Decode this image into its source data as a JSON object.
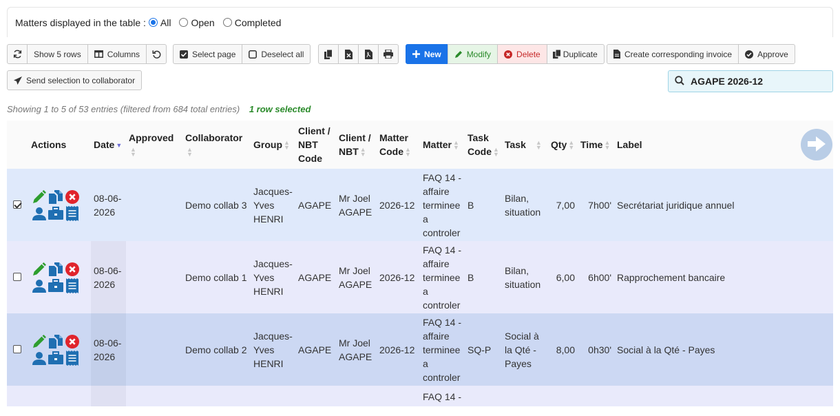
{
  "filter": {
    "label": "Matters displayed in the table :",
    "options": [
      "All",
      "Open",
      "Completed"
    ],
    "selected": "All"
  },
  "toolbar": {
    "show_rows": "Show 5 rows",
    "columns": "Columns",
    "select_page": "Select page",
    "deselect_all": "Deselect all",
    "new": "New",
    "modify": "Modify",
    "delete": "Delete",
    "duplicate": "Duplicate",
    "create_invoice": "Create corresponding invoice",
    "approve": "Approve",
    "send_selection": "Send selection to collaborator"
  },
  "search": {
    "value": "AGAPE 2026-12"
  },
  "info": {
    "showing": "Showing 1 to 5 of 53 entries (filtered from 684 total entries)",
    "selected": "1 row selected"
  },
  "table": {
    "headers": {
      "actions": "Actions",
      "date": "Date",
      "approved": "Approved",
      "collaborator": "Collaborator",
      "group": "Group",
      "client_code": "Client / NBT Code",
      "client": "Client / NBT",
      "matter_code": "Matter Code",
      "matter": "Matter",
      "task_code": "Task Code",
      "task": "Task",
      "qty": "Qty",
      "time": "Time",
      "label": "Label"
    },
    "rows": [
      {
        "selected": true,
        "date": "08-06-2026",
        "approved": "",
        "collaborator": "Demo collab 3",
        "group": "Jacques-Yves HENRI",
        "client_code": "AGAPE",
        "client": "Mr Joel AGAPE",
        "matter_code": "2026-12",
        "matter": "FAQ 14 - affaire terminee a controler",
        "task_code": "B",
        "task": "Bilan, situation",
        "qty": "7,00",
        "time": "7h00'",
        "label": "Secrétariat juridique annuel"
      },
      {
        "selected": false,
        "date": "08-06-2026",
        "approved": "",
        "collaborator": "Demo collab 1",
        "group": "Jacques-Yves HENRI",
        "client_code": "AGAPE",
        "client": "Mr Joel AGAPE",
        "matter_code": "2026-12",
        "matter": "FAQ 14 - affaire terminee a controler",
        "task_code": "B",
        "task": "Bilan, situation",
        "qty": "6,00",
        "time": "6h00'",
        "label": "Rapprochement bancaire"
      },
      {
        "selected": false,
        "date": "08-06-2026",
        "approved": "",
        "collaborator": "Demo collab 2",
        "group": "Jacques-Yves HENRI",
        "client_code": "AGAPE",
        "client": "Mr Joel AGAPE",
        "matter_code": "2026-12",
        "matter": "FAQ 14 - affaire terminee a controler",
        "task_code": "SQ-P",
        "task": "Social à la Qté - Payes",
        "qty": "8,00",
        "time": "0h30'",
        "label": "Social à la Qté - Payes"
      },
      {
        "selected": false,
        "date": "",
        "approved": "",
        "collaborator": "",
        "group": "",
        "client_code": "",
        "client": "",
        "matter_code": "",
        "matter": "FAQ 14 -",
        "task_code": "",
        "task": "",
        "qty": "",
        "time": "",
        "label": ""
      }
    ]
  },
  "icons": {
    "accent": "#1a73e8",
    "action_blue": "#1f6fb2",
    "edit_green": "#2e9e2e",
    "delete_red": "#e0242c"
  }
}
